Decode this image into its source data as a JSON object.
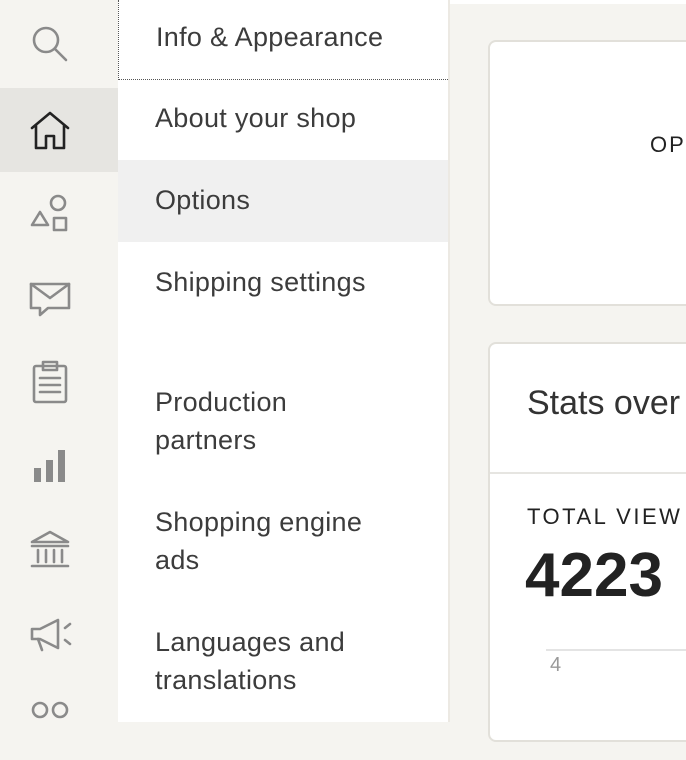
{
  "rail": {
    "items": [
      {
        "icon": "search-icon",
        "active": false
      },
      {
        "icon": "home-icon",
        "active": true
      },
      {
        "icon": "shapes-icon",
        "active": false
      },
      {
        "icon": "message-icon",
        "active": false
      },
      {
        "icon": "clipboard-icon",
        "active": false
      },
      {
        "icon": "stats-icon",
        "active": false
      },
      {
        "icon": "finances-icon",
        "active": false
      },
      {
        "icon": "megaphone-icon",
        "active": false
      },
      {
        "icon": "community-icon",
        "active": false
      }
    ]
  },
  "menu": {
    "items": [
      {
        "label": "Info & Appearance"
      },
      {
        "label": "About your shop"
      },
      {
        "label": "Options"
      },
      {
        "label": "Shipping settings"
      },
      {
        "label": "Production\npartners"
      },
      {
        "label": "Shopping engine\nads"
      },
      {
        "label": "Languages and\ntranslations"
      }
    ]
  },
  "main": {
    "card1_heading": "OP",
    "stats_title": "Stats over",
    "views_label": "TOTAL VIEW",
    "views_value": "4223",
    "axis_tick": "4"
  }
}
